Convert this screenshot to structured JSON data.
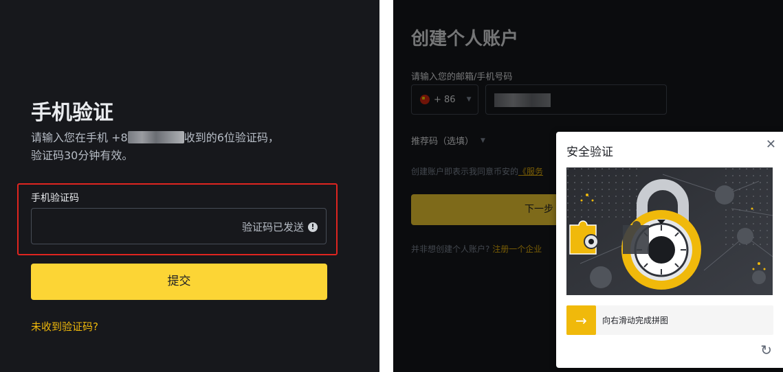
{
  "left_panel": {
    "title": "手机验证",
    "desc_prefix": "请输入您在手机 +8",
    "desc_suffix": "收到的6位验证码，",
    "desc_line2": "验证码30分钟有效。",
    "code_label": "手机验证码",
    "code_value": "",
    "sent_note": "验证码已发送",
    "submit_label": "提交",
    "no_code_link": "未收到验证码?"
  },
  "right_panel": {
    "title": "创建个人账户",
    "email_phone_label": "请输入您的邮箱/手机号码",
    "country_code": "+ 86",
    "referral_label": "推荐码（选填）",
    "terms_text": "创建账户即表示我同意币安的",
    "terms_link": "《服务",
    "next_label": "下一步",
    "corp_text": "并非想创建个人账户?",
    "corp_link": "注册一个企业"
  },
  "security_modal": {
    "title": "安全验证",
    "close_glyph": "✕",
    "slider_text": "向右滑动完成拼图",
    "slider_glyph": "→",
    "refresh_glyph": "↻"
  },
  "colors": {
    "background": "#17181c",
    "accent_yellow": "#fcd535",
    "link_yellow": "#f0b90b",
    "error_red": "#e02520"
  }
}
